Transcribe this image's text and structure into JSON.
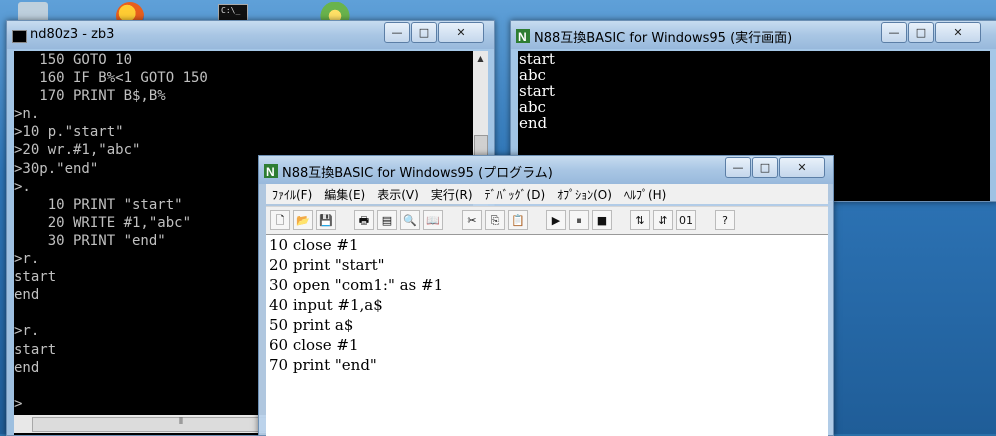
{
  "console_window": {
    "title": "nd80z3 - zb3",
    "lines": [
      "   150 GOTO 10",
      "   160 IF B%<1 GOTO 150",
      "   170 PRINT B$,B%",
      ">n.",
      ">10 p.\"start\"",
      ">20 wr.#1,\"abc\"",
      ">30p.\"end\"",
      ">.",
      "    10 PRINT \"start\"",
      "    20 WRITE #1,\"abc\"",
      "    30 PRINT \"end\"",
      ">r.",
      "start",
      "end",
      "",
      ">r.",
      "start",
      "end",
      "",
      ">"
    ]
  },
  "output_window": {
    "title": "N88互換BASIC for Windows95 (実行画面)",
    "lines": [
      "start",
      "abc",
      "start",
      "abc",
      "end"
    ]
  },
  "program_window": {
    "title": "N88互換BASIC for Windows95 (プログラム)",
    "menu": [
      "ﾌｧｲﾙ(F)",
      "編集(E)",
      "表示(V)",
      "実行(R)",
      "ﾃﾞﾊﾞｯｸﾞ(D)",
      "ｵﾌﾟｼｮﾝ(O)",
      "ﾍﾙﾌﾟ(H)"
    ],
    "code": [
      "10 close #1",
      "20 print \"start\"",
      "30 open \"com1:\" as #1",
      "40 input #1,a$",
      "50 print a$",
      "60 close #1",
      "70 print \"end\""
    ]
  },
  "window_controls": {
    "minimize": "—",
    "maximize": "□",
    "close": "✕"
  },
  "toolbar_icons": [
    "new-file-icon",
    "open-folder-icon",
    "save-icon",
    "print-icon",
    "print-preview-icon",
    "find-icon",
    "book-icon",
    "cut-icon",
    "copy-icon",
    "paste-icon",
    "run-icon",
    "pause-icon",
    "stop-icon",
    "renumber-icon",
    "sort-icon",
    "binary-icon",
    "help-icon"
  ],
  "toolbar_glyphs": [
    "🗋",
    "📂",
    "💾",
    "🖶",
    "▤",
    "🔍",
    "📖",
    "✂",
    "⎘",
    "📋",
    "▶",
    "⏸",
    "■",
    "⇅",
    "⇵",
    "01",
    "?"
  ]
}
